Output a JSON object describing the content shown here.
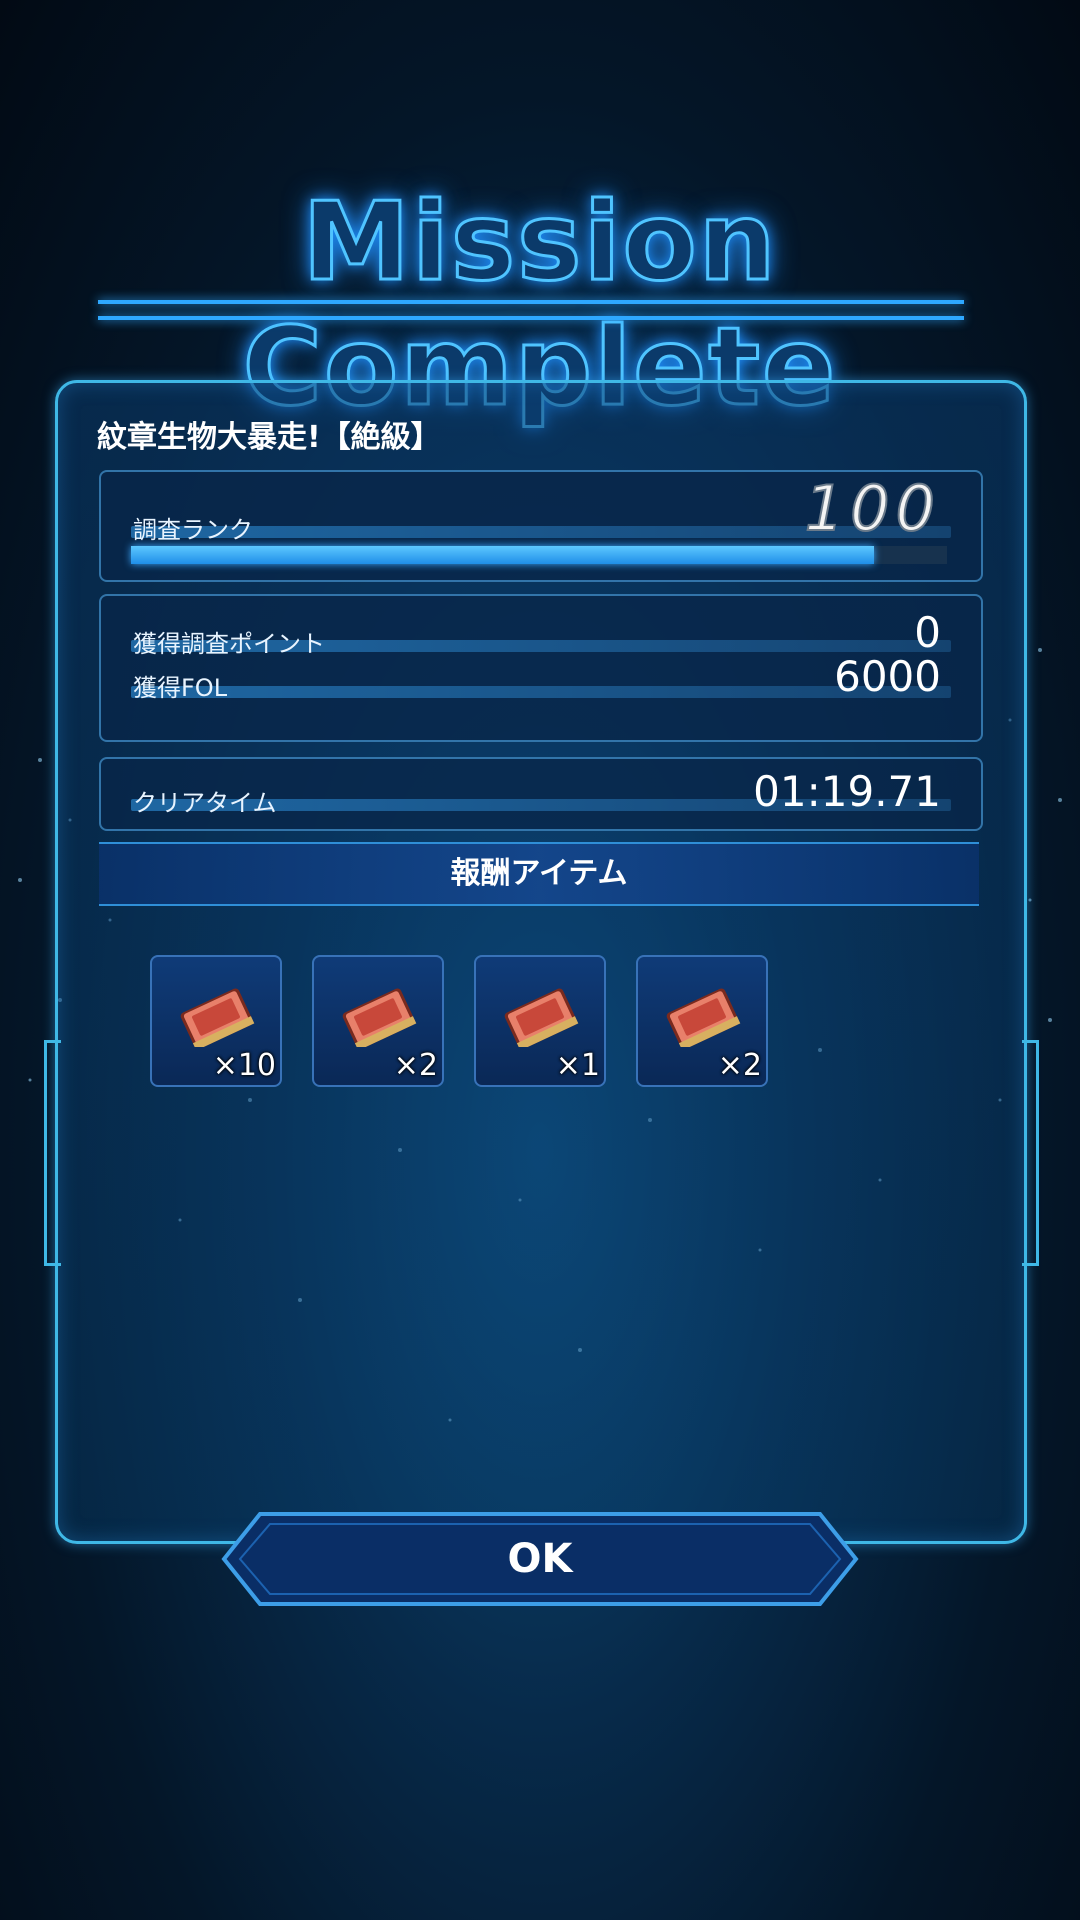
{
  "title": "Mission Complete",
  "mission_name": "紋章生物大暴走!【絶級】",
  "rank": {
    "label": "調査ランク",
    "value": "100",
    "progress_fraction": 0.91
  },
  "points": {
    "research_points_label": "獲得調査ポイント",
    "research_points_value": "0",
    "fol_label": "獲得FOL",
    "fol_value": "6000"
  },
  "clear_time": {
    "label": "クリアタイム",
    "value": "01:19.71"
  },
  "rewards": {
    "header": "報酬アイテム",
    "items": [
      {
        "icon": "ticket-icon",
        "quantity": "×10"
      },
      {
        "icon": "ticket-icon",
        "quantity": "×2"
      },
      {
        "icon": "ticket-icon",
        "quantity": "×1"
      },
      {
        "icon": "ticket-icon",
        "quantity": "×2"
      }
    ]
  },
  "ok_button": "OK",
  "colors": {
    "accent": "#3fb8e6",
    "bar": "#1f8ee8",
    "background": "#041628"
  }
}
